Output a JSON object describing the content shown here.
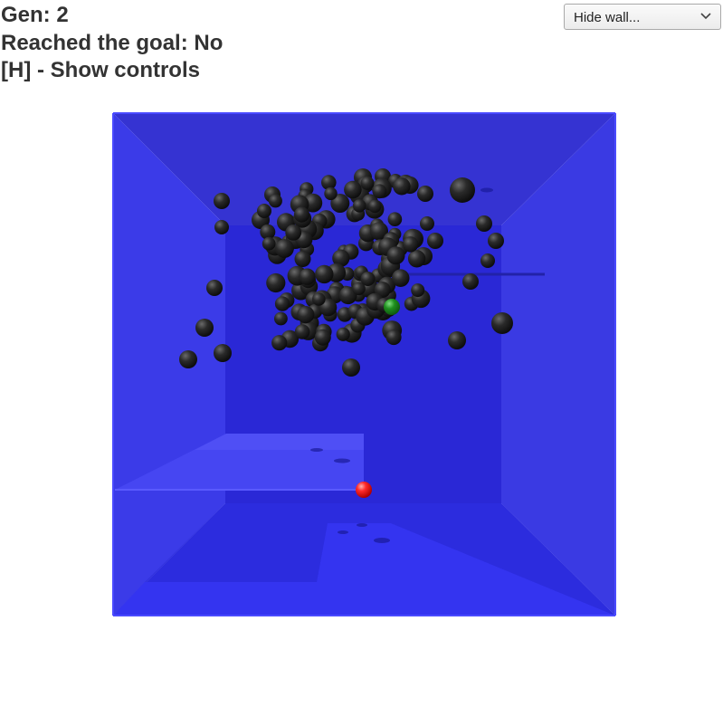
{
  "hud": {
    "generation_label": "Gen:",
    "generation": "2",
    "goal_label": "Reached the goal:",
    "goal_status": "No",
    "controls_hint": "[H] - Show controls"
  },
  "wall_select": {
    "selected": "Hide wall...",
    "icon": "chevron-down-icon"
  },
  "scene": {
    "colors": {
      "room": "#2b2be8",
      "population_ball": "#1c1c1c",
      "goal": "#ff2a2a",
      "best_ball": "#1f8f1f"
    },
    "population_count": 150
  }
}
